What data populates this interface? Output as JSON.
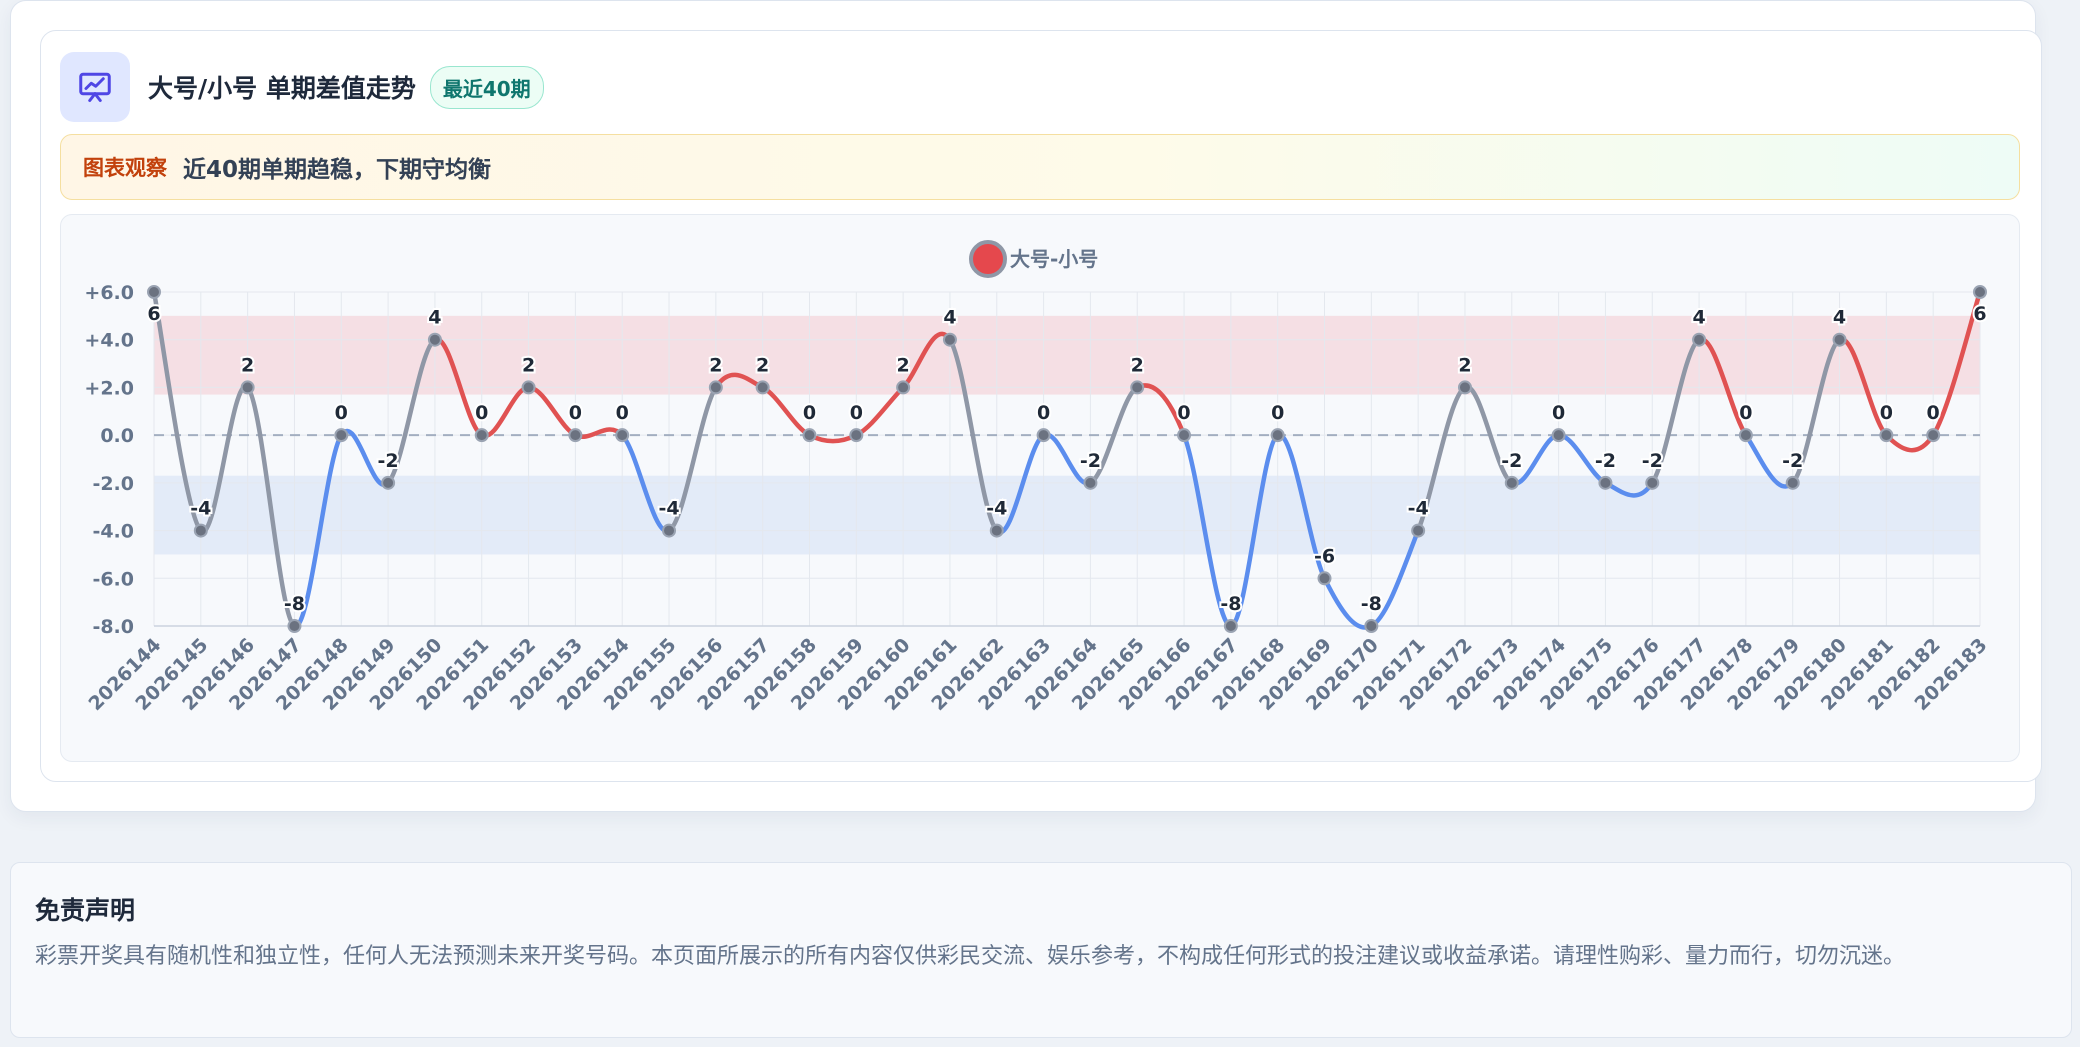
{
  "header": {
    "title": "大号/小号 单期差值走势",
    "badge": "最近40期",
    "icon": "chart-presentation-icon"
  },
  "notice": {
    "label": "图表观察",
    "text": "近40期单期趋稳，下期守均衡"
  },
  "chart_data": {
    "type": "line",
    "legend": "大号-小号",
    "legend_position": "top-center",
    "categories": [
      "2026144",
      "2026145",
      "2026146",
      "2026147",
      "2026148",
      "2026149",
      "2026150",
      "2026151",
      "2026152",
      "2026153",
      "2026154",
      "2026155",
      "2026156",
      "2026157",
      "2026158",
      "2026159",
      "2026160",
      "2026161",
      "2026162",
      "2026163",
      "2026164",
      "2026165",
      "2026166",
      "2026167",
      "2026168",
      "2026169",
      "2026170",
      "2026171",
      "2026172",
      "2026173",
      "2026174",
      "2026175",
      "2026176",
      "2026177",
      "2026178",
      "2026179",
      "2026180",
      "2026181",
      "2026182",
      "2026183"
    ],
    "series": [
      {
        "name": "大号-小号",
        "values": [
          6,
          -4,
          2,
          -8,
          0,
          -2,
          4,
          0,
          2,
          0,
          0,
          -4,
          2,
          2,
          0,
          0,
          2,
          4,
          -4,
          0,
          -2,
          2,
          0,
          -8,
          0,
          -6,
          -8,
          -4,
          2,
          -2,
          0,
          -2,
          -2,
          4,
          0,
          -2,
          4,
          0,
          0,
          6
        ]
      }
    ],
    "yticks": [
      "+6.0",
      "+4.0",
      "+2.0",
      "0.0",
      "-2.0",
      "-4.0",
      "-6.0",
      "-8.0"
    ],
    "ylim": [
      -8,
      6
    ],
    "bands": [
      {
        "from": 1.7,
        "to": 5,
        "color": "#f5dfe4"
      },
      {
        "from": -5,
        "to": -1.7,
        "color": "#e3ebf8"
      }
    ],
    "grid": true,
    "colors": {
      "positive": "#e05252",
      "negative": "#5b8dee",
      "neutral": "#8f97a6",
      "point": "#6b7280",
      "legend_dot": "#e5484d",
      "zero_line": "#a3aec0",
      "grid": "#e4e8ee",
      "tick_label": "#64748b",
      "value_label": "#1f2937"
    }
  },
  "disclaimer": {
    "title": "免责声明",
    "text": "彩票开奖具有随机性和独立性，任何人无法预测未来开奖号码。本页面所展示的所有内容仅供彩民交流、娱乐参考，不构成任何形式的投注建议或收益承诺。请理性购彩、量力而行，切勿沉迷。"
  }
}
